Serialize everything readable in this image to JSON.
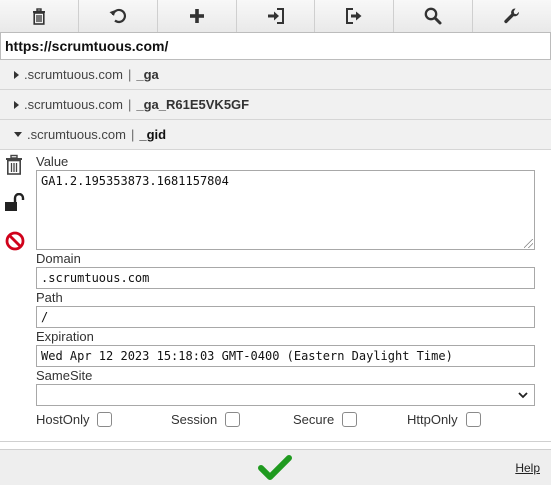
{
  "toolbar": {
    "buttons": [
      {
        "name": "trash-icon"
      },
      {
        "name": "undo-icon"
      },
      {
        "name": "plus-icon"
      },
      {
        "name": "import-icon"
      },
      {
        "name": "export-icon"
      },
      {
        "name": "search-icon"
      },
      {
        "name": "wrench-icon"
      }
    ]
  },
  "url": "https://scrumtuous.com/",
  "cookies": [
    {
      "domain": ".scrumtuous.com",
      "separator": "|",
      "name": "_ga"
    },
    {
      "domain": ".scrumtuous.com",
      "separator": "|",
      "name": "_ga_R61E5VK5GF"
    },
    {
      "domain": ".scrumtuous.com",
      "separator": "|",
      "name": "_gid"
    }
  ],
  "detail": {
    "value_label": "Value",
    "value": "GA1.2.195353873.1681157804",
    "domain_label": "Domain",
    "domain": ".scrumtuous.com",
    "path_label": "Path",
    "path": "/",
    "expiration_label": "Expiration",
    "expiration": "Wed Apr 12 2023 15:18:03 GMT-0400 (Eastern Daylight Time)",
    "samesite_label": "SameSite",
    "samesite_value": "",
    "host_only_label": "HostOnly",
    "session_label": "Session",
    "secure_label": "Secure",
    "http_only_label": "HttpOnly"
  },
  "footer": {
    "help_label": "Help"
  },
  "colors": {
    "save_green": "#1f9a1f",
    "block_red": "#d0021b"
  }
}
